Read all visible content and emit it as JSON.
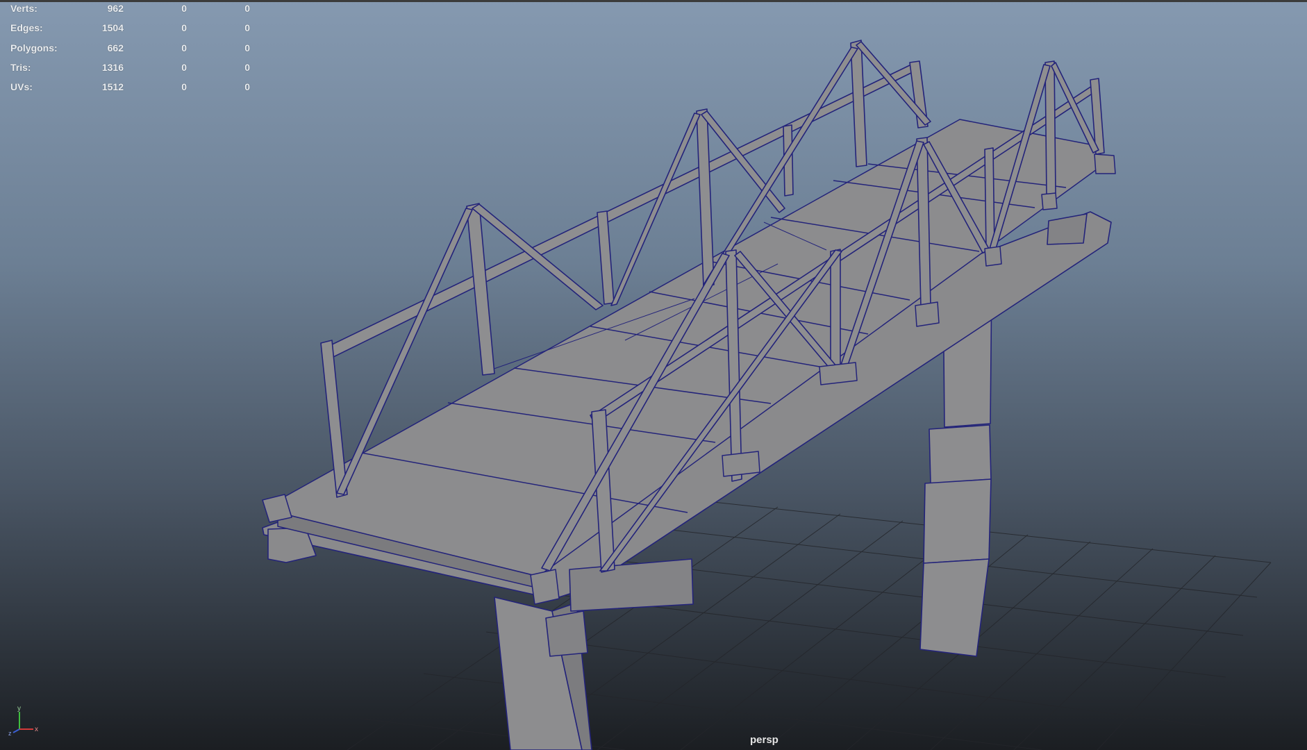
{
  "hud": {
    "rows": [
      {
        "label": "Verts:",
        "v1": "962",
        "v2": "0",
        "v3": "0"
      },
      {
        "label": "Edges:",
        "v1": "1504",
        "v2": "0",
        "v3": "0"
      },
      {
        "label": "Polygons:",
        "v1": "662",
        "v2": "0",
        "v3": "0"
      },
      {
        "label": "Tris:",
        "v1": "1316",
        "v2": "0",
        "v3": "0"
      },
      {
        "label": "UVs:",
        "v1": "1512",
        "v2": "0",
        "v3": "0"
      }
    ]
  },
  "viewport": {
    "camera_label": "persp"
  },
  "axis": {
    "y": "y",
    "x": "x",
    "z": "z"
  },
  "colors": {
    "mesh_fill": "#8a8a8c",
    "wireframe": "#23237a",
    "grid": "#2a2c30"
  }
}
